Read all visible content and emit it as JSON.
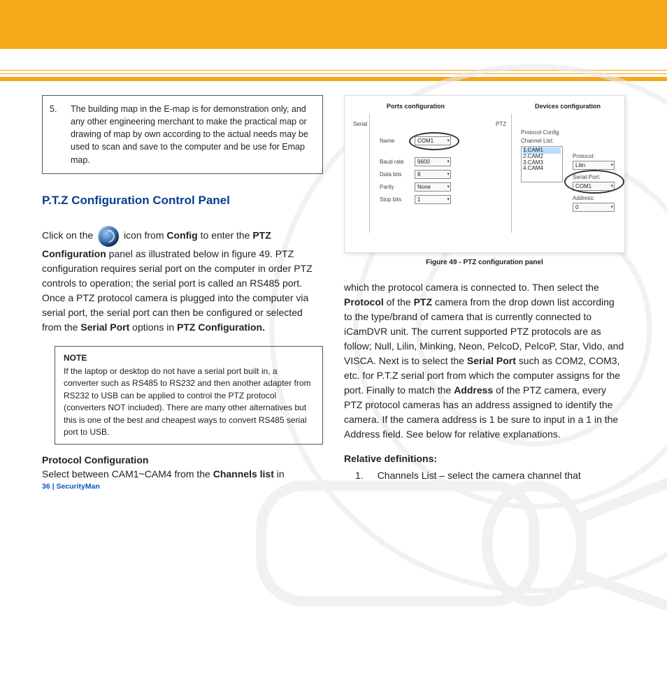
{
  "callout": {
    "num": "5.",
    "text": "The building map in the E-map is for demonstration only, and any other engineering merchant to make the practical map or drawing of map by own according to the actual needs may be used to scan and save to the computer and be use for Emap map."
  },
  "section_title": "P.T.Z Configuration Control Panel",
  "para1_a": "Click on the ",
  "para1_b": " icon from ",
  "cfg_word": "Config",
  "para1_c": " to enter the ",
  "ptz_conf": "PTZ Configuration",
  "para1_d": " panel as illustrated below in figure 49. PTZ configuration requires serial port on the computer in order PTZ controls to operation; the serial port is called an RS485 port.   Once a PTZ protocol camera is plugged into the computer via serial port, the serial port can then be configured or selected from the ",
  "serial_port": "Serial Port",
  "para1_e": " options in ",
  "ptz_conf2": "PTZ Configuration.",
  "note": {
    "head": "NOTE",
    "body": "If the laptop or desktop do not have a serial port built in, a converter such as RS485 to RS232 and then another adapter from RS232 to USB can be applied to control the PTZ protocol (converters NOT included).  There are many other alternatives but this is one of the best and cheapest ways to convert RS485 serial port to USB."
  },
  "protoconf_head": "Protocol Configuration",
  "protoconf_text_a": "Select between CAM1~CAM4 from the ",
  "channels_list": "Channels list",
  "protoconf_text_b": " in",
  "figure": {
    "caption": "Figure 49 - PTZ configuration panel",
    "ports_hdr": "Ports configuration",
    "dev_hdr": "Devices configuration",
    "serial": "Serial",
    "ptz": "PTZ",
    "name": "Name",
    "name_val": "COM1",
    "baud": "Baud rate",
    "baud_val": "9600",
    "databits": "Data bits",
    "databits_val": "8",
    "parity": "Parity",
    "parity_val": "None",
    "stop": "Stop bits",
    "stop_val": "1",
    "protoconfig": "Protocol Config",
    "chanlist": "Channel List:",
    "ch_items": [
      "1.CAM1",
      "2.CAM2",
      "3.CAM3",
      "4.CAM4"
    ],
    "protocol": "Protocol:",
    "protocol_val": "Lilin",
    "serialport": "Serial Port:",
    "serialport_val": "COM1",
    "address": "Address:",
    "address_val": "0"
  },
  "right_para_a": "which the protocol camera is connected to.  Then select the ",
  "protocol_bold": "Protocol",
  "right_para_b": " of the ",
  "ptz_bold": "PTZ",
  "right_para_c": " camera from the drop down list according to the type/brand of camera that is currently connected to iCamDVR unit.  The current supported PTZ protocols are as follow; Null, Lilin, Minking, Neon, PelcoD, PelcoP, Star, Vido, and VISCA.   Next is to select the ",
  "serial_port_bold": "Serial Port",
  "right_para_d": " such as COM2, COM3, etc. for P.T.Z serial port from which the computer assigns for the port.  Finally to match the ",
  "address_bold": "Address",
  "right_para_e": " of the PTZ camera, every PTZ protocol cameras has an address assigned to identify the camera.  If the camera address is 1 be sure to input in a 1 in the Address field.  See below for relative explanations.",
  "reldef_head": "Relative definitions:",
  "reldef_1_num": "1.",
  "reldef_1_text": "Channels List – select the camera channel that",
  "footer": "36  |  SecurityMan"
}
